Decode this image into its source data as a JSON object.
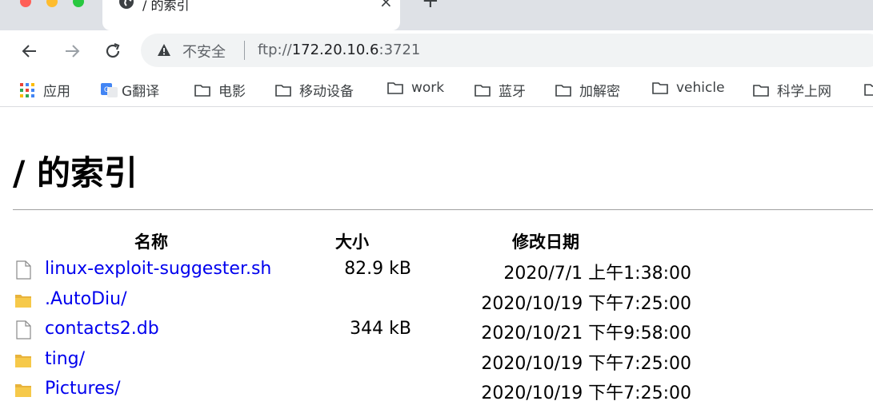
{
  "tab": {
    "title": "/ 的索引",
    "close": "×",
    "new_tab": "+"
  },
  "toolbar": {
    "security_label": "不安全",
    "url_scheme": "ftp://",
    "url_host": "172.20.10.6",
    "url_port": ":3721"
  },
  "bookmarks": [
    {
      "label": "应用",
      "icon": "apps-grid-icon"
    },
    {
      "label": "G翻译",
      "icon": "google-translate-icon"
    },
    {
      "label": "电影",
      "icon": "folder-icon"
    },
    {
      "label": "移动设备",
      "icon": "folder-icon"
    },
    {
      "label": "work",
      "icon": "folder-icon"
    },
    {
      "label": "蓝牙",
      "icon": "folder-icon"
    },
    {
      "label": "加解密",
      "icon": "folder-icon"
    },
    {
      "label": "vehicle",
      "icon": "folder-icon"
    },
    {
      "label": "科学上网",
      "icon": "folder-icon"
    }
  ],
  "page": {
    "title": "/ 的索引",
    "columns": {
      "name": "名称",
      "size": "大小",
      "modified": "修改日期"
    },
    "entries": [
      {
        "name": "linux-exploit-suggester.sh",
        "size": "82.9 kB",
        "modified": "2020/7/1 上午1:38:00",
        "type": "file"
      },
      {
        "name": ".AutoDiu/",
        "size": "",
        "modified": "2020/10/19 下午7:25:00",
        "type": "folder"
      },
      {
        "name": "contacts2.db",
        "size": "344 kB",
        "modified": "2020/10/21 下午9:58:00",
        "type": "file"
      },
      {
        "name": "ting/",
        "size": "",
        "modified": "2020/10/19 下午7:25:00",
        "type": "folder"
      },
      {
        "name": "Pictures/",
        "size": "",
        "modified": "2020/10/19 下午7:25:00",
        "type": "folder"
      }
    ]
  }
}
